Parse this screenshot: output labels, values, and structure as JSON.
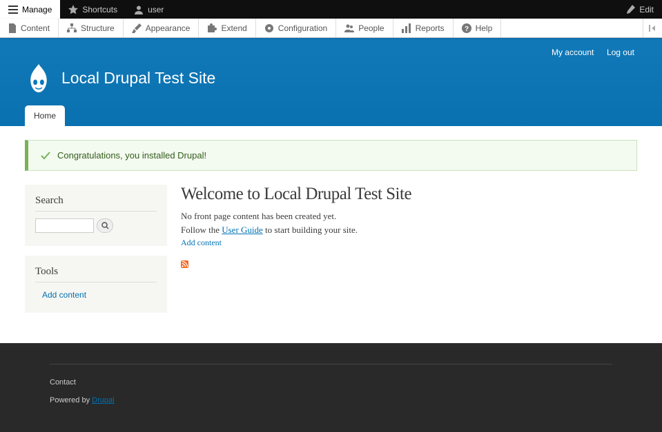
{
  "toolbar": {
    "manage": "Manage",
    "shortcuts": "Shortcuts",
    "user": "user",
    "edit": "Edit"
  },
  "admin_menu": {
    "content": "Content",
    "structure": "Structure",
    "appearance": "Appearance",
    "extend": "Extend",
    "configuration": "Configuration",
    "people": "People",
    "reports": "Reports",
    "help": "Help"
  },
  "header": {
    "my_account": "My account",
    "log_out": "Log out",
    "site_name": "Local Drupal Test Site"
  },
  "tabs": {
    "home": "Home"
  },
  "status": {
    "message": "Congratulations, you installed Drupal!"
  },
  "sidebar": {
    "search": {
      "title": "Search"
    },
    "tools": {
      "title": "Tools",
      "add_content": "Add content"
    }
  },
  "main": {
    "title": "Welcome to Local Drupal Test Site",
    "no_content": "No front page content has been created yet.",
    "follow_prefix": "Follow the ",
    "user_guide": "User Guide",
    "follow_suffix": " to start building your site.",
    "add_content": "Add content"
  },
  "footer": {
    "contact": "Contact",
    "powered_by": "Powered by ",
    "drupal": "Drupal"
  }
}
